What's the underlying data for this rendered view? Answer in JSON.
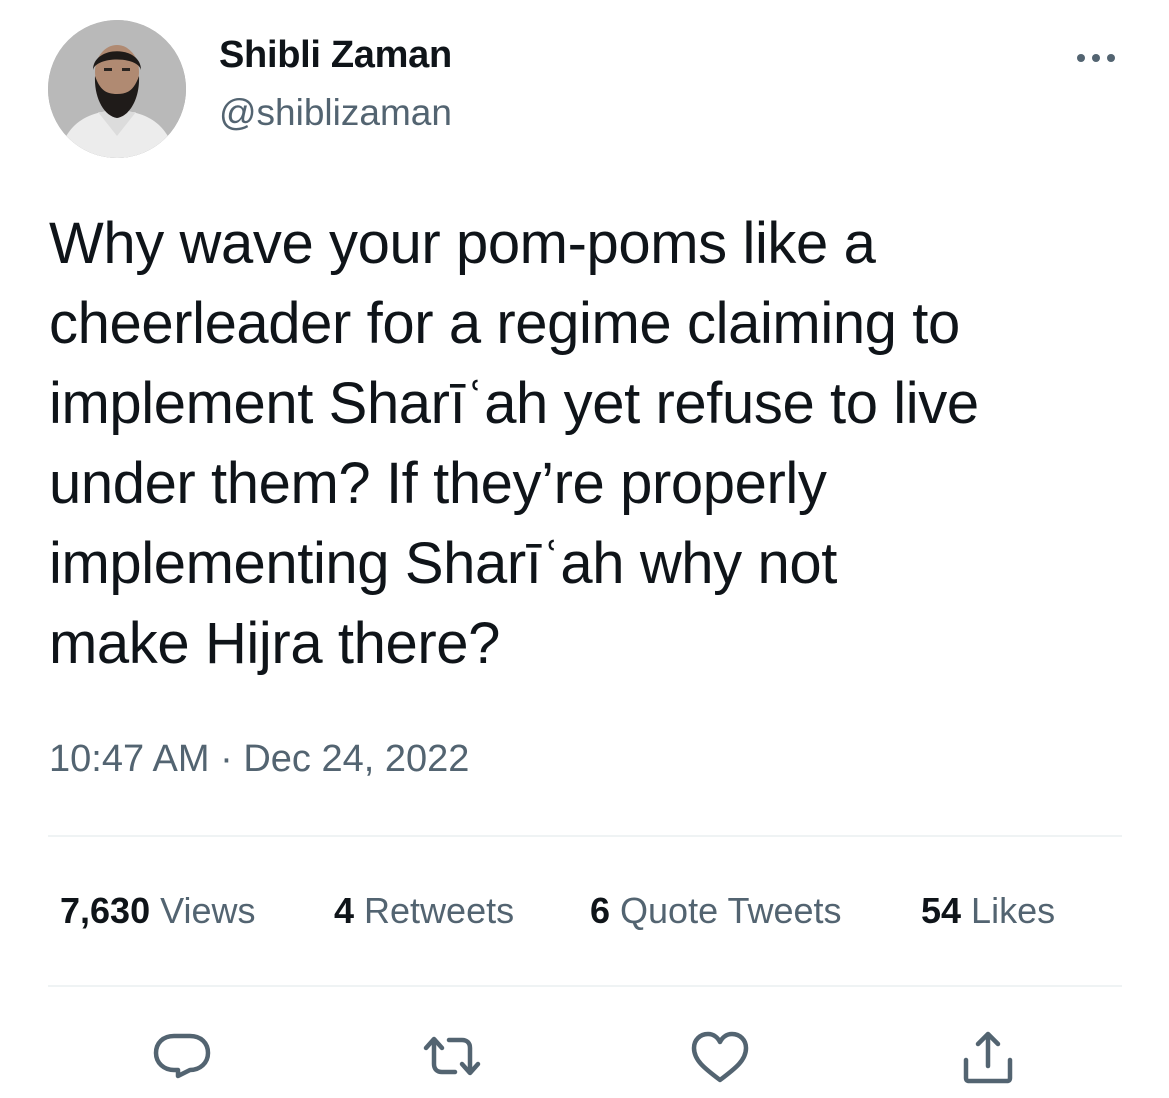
{
  "user": {
    "display_name": "Shibli Zaman",
    "handle": "@shiblizaman"
  },
  "tweet": {
    "lines": [
      "Why wave your pom-poms like a",
      "cheerleader for a regime claiming to",
      "implement Sharīʿah yet refuse to live",
      "under them? If they’re properly",
      "implementing Sharīʿah why not",
      "make Hijra there?"
    ],
    "time": "10:47 AM",
    "separator": " · ",
    "date": "Dec 24, 2022"
  },
  "stats": {
    "views": {
      "count": "7,630",
      "label": " Views"
    },
    "retweets": {
      "count": "4",
      "label": " Retweets"
    },
    "quotes": {
      "count": "6",
      "label": " Quote Tweets"
    },
    "likes": {
      "count": "54",
      "label": " Likes"
    }
  },
  "icons": {
    "more": "more-horizontal-icon",
    "reply": "reply-icon",
    "retweet": "retweet-icon",
    "like": "heart-icon",
    "share": "share-icon"
  },
  "colors": {
    "text": "#0f1419",
    "secondary": "#536471",
    "divider": "#eff3f4"
  }
}
